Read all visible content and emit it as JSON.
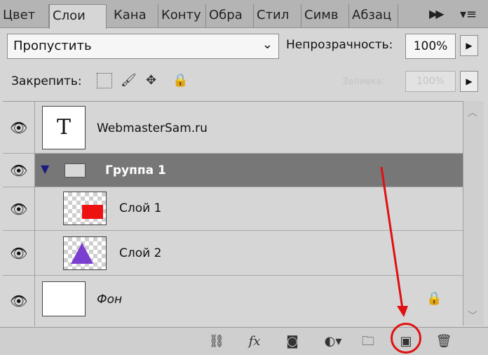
{
  "tabs": [
    {
      "label": "Цвет",
      "active": false
    },
    {
      "label": "Слои",
      "active": true
    },
    {
      "label": "Кана",
      "active": false
    },
    {
      "label": "Конту",
      "active": false
    },
    {
      "label": "Обра",
      "active": false
    },
    {
      "label": "Стил",
      "active": false
    },
    {
      "label": "Симв",
      "active": false
    },
    {
      "label": "Абзац",
      "active": false
    }
  ],
  "toolbar": {
    "blend_mode": "Пропустить",
    "opacity_label": "Непрозрачность:",
    "opacity_value": "100%",
    "lock_label": "Закрепить:",
    "fill_label": "Заливка:",
    "fill_value": "100%"
  },
  "layers": [
    {
      "name": "WebmasterSam.ru",
      "type": "text",
      "thumb_glyph": "T"
    },
    {
      "name": "Группа 1",
      "type": "group",
      "selected": true
    },
    {
      "name": "Слой 1",
      "type": "layer",
      "shape_color": "#ee1111"
    },
    {
      "name": "Слой 2",
      "type": "layer",
      "shape_color": "#7a3fd0"
    },
    {
      "name": "Фон",
      "type": "background",
      "locked": true
    }
  ],
  "colors": {
    "selected_row": "#777777",
    "annotation": "#e01010"
  },
  "icons": [
    "eye-icon",
    "link-icon",
    "fx-icon",
    "mask-icon",
    "adjustment-icon",
    "folder-icon",
    "new-layer-icon",
    "trash-icon"
  ]
}
